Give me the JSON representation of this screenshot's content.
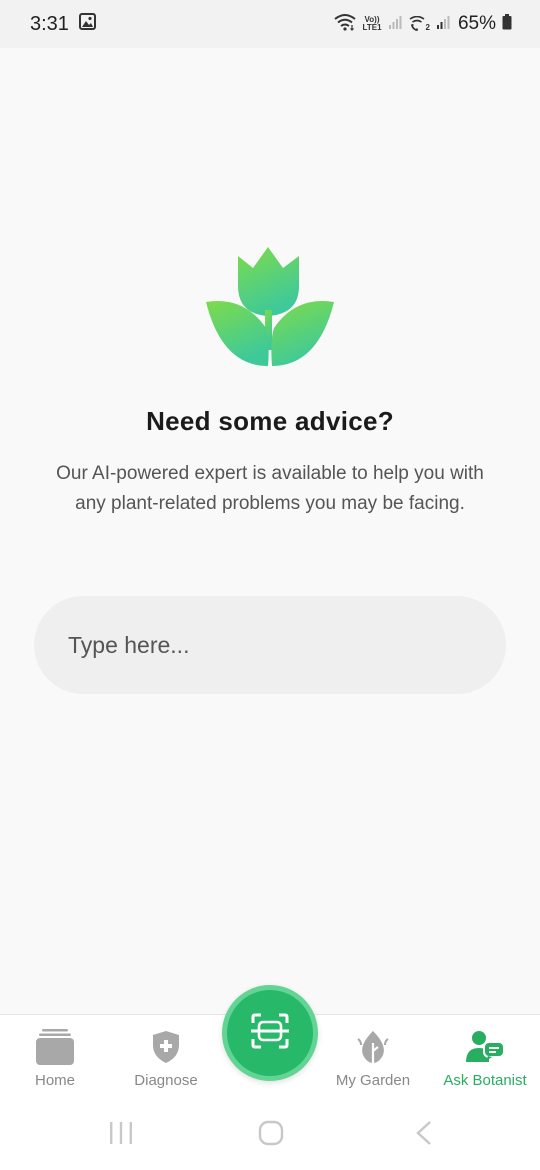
{
  "status_bar": {
    "time": "3:31",
    "lte_top": "Vo))",
    "lte_bottom": "LTE1",
    "sim2": "2",
    "battery": "65%"
  },
  "hero": {
    "logo_icon": "tulip-icon",
    "title": "Need some advice?",
    "description": "Our AI-powered expert is available to help you with any plant-related problems you may be facing."
  },
  "chat": {
    "placeholder": "Type here..."
  },
  "bottom_nav": {
    "items": [
      {
        "label": "Home",
        "icon": "home-stack-icon"
      },
      {
        "label": "Diagnose",
        "icon": "shield-plus-icon"
      },
      {
        "label": "My Garden",
        "icon": "leaf-icon"
      },
      {
        "label": "Ask Botanist",
        "icon": "botanist-chat-icon"
      }
    ],
    "active": "Ask Botanist",
    "scan_icon": "scan-icon"
  },
  "colors": {
    "accent": "#27b86a",
    "accent_light": "#62d493",
    "active_label": "#27ae60",
    "inactive": "#9e9e9e"
  }
}
